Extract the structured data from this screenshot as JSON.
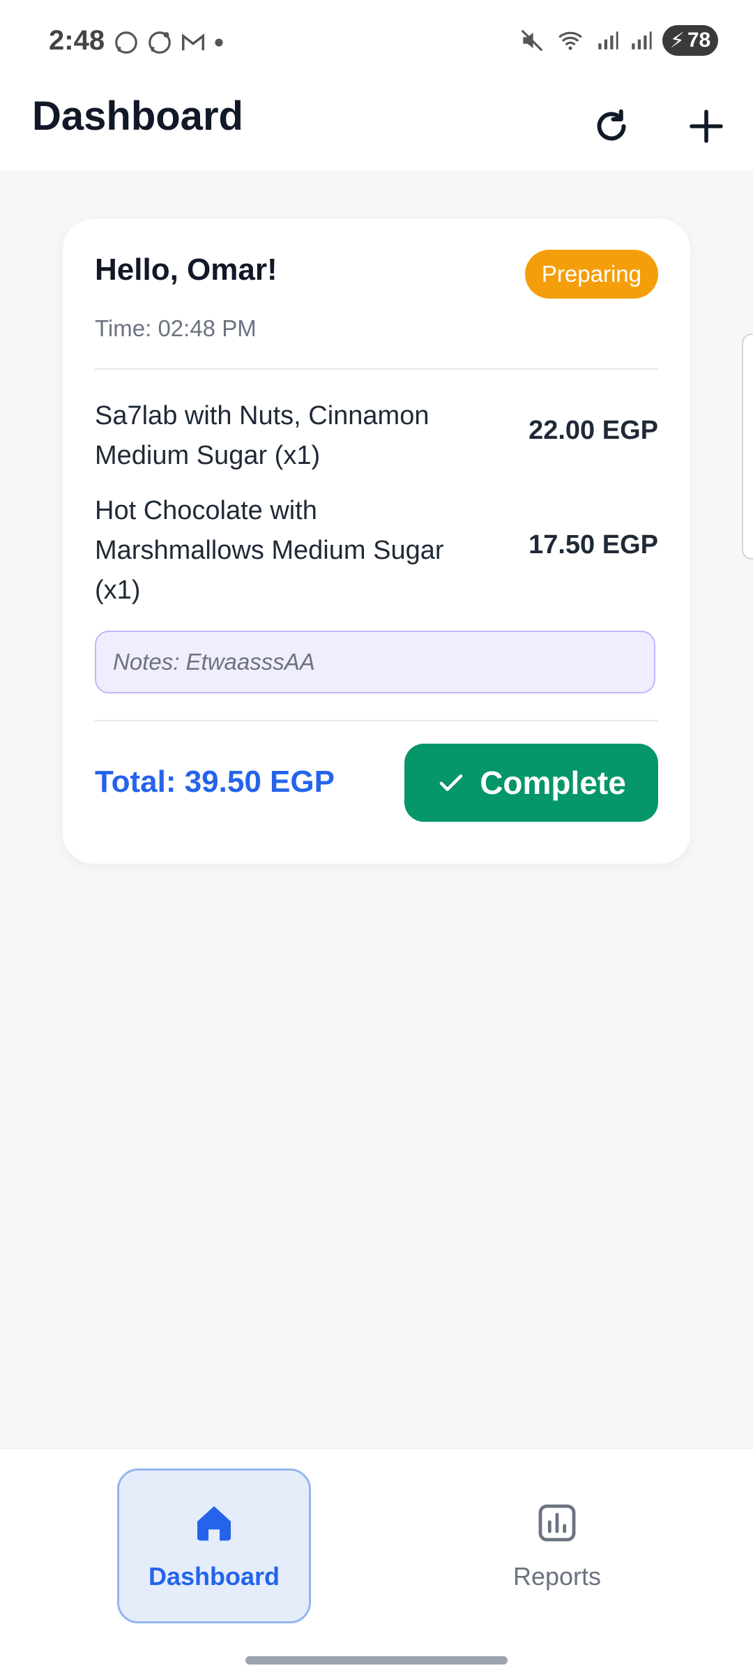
{
  "status_bar": {
    "time": "2:48",
    "battery": "78"
  },
  "app_bar": {
    "title": "Dashboard"
  },
  "order": {
    "greeting": "Hello, Omar!",
    "status": "Preparing",
    "time": "Time: 02:48 PM",
    "items": [
      {
        "name": "Sa7lab with Nuts, Cinnamon Medium Sugar (x1)",
        "price": "22.00 EGP"
      },
      {
        "name": "Hot Chocolate with Marshmallows Medium Sugar (x1)",
        "price": "17.50 EGP"
      }
    ],
    "notes": "Notes: EtwaasssAA",
    "total": "Total: 39.50 EGP",
    "complete_label": "Complete"
  },
  "bottom_nav": {
    "items": [
      {
        "label": "Dashboard",
        "icon": "home-icon",
        "active": true
      },
      {
        "label": "Reports",
        "icon": "bar-chart-icon",
        "active": false
      }
    ]
  },
  "colors": {
    "accent": "#2563eb",
    "status_preparing": "#f59e0b",
    "complete": "#059669"
  }
}
